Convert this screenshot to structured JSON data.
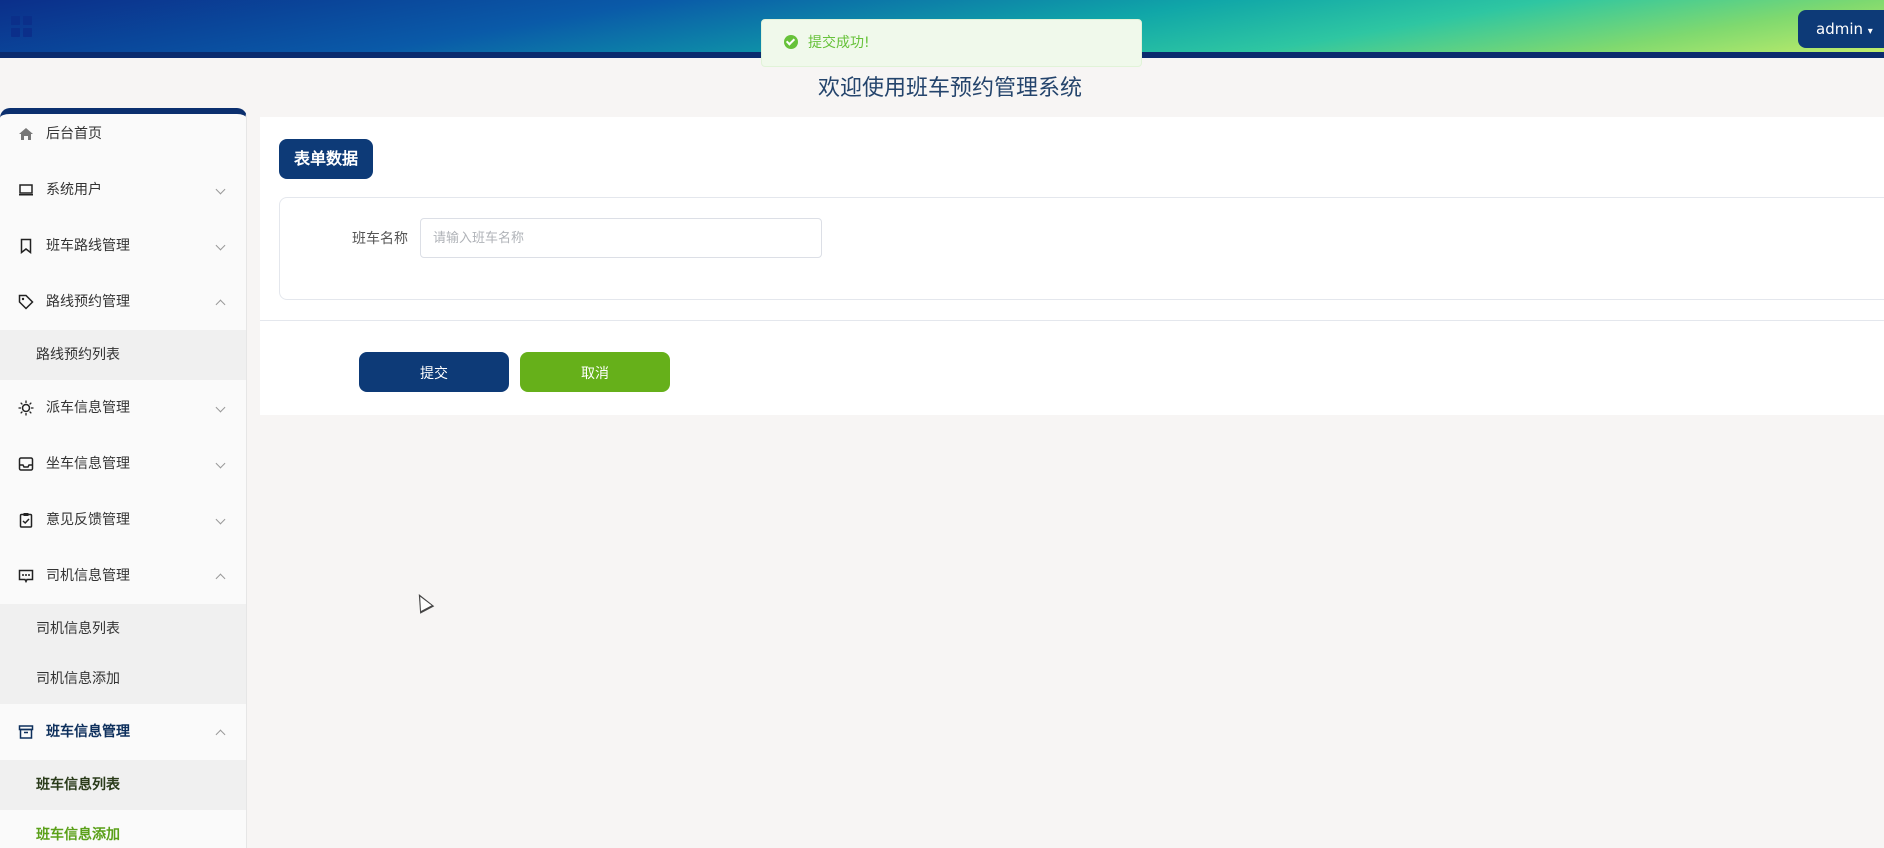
{
  "header": {
    "admin_label": "admin",
    "accent_color": "#0d3a77"
  },
  "toast": {
    "message": "提交成功!"
  },
  "welcome": {
    "title": "欢迎使用班车预约管理系统"
  },
  "sidebar": {
    "items": [
      {
        "label": "后台首页",
        "icon": "home-icon"
      },
      {
        "label": "系统用户",
        "icon": "monitor-icon"
      },
      {
        "label": "班车路线管理",
        "icon": "bookmark-icon"
      },
      {
        "label": "路线预约管理",
        "icon": "tag-icon"
      },
      {
        "label": "派车信息管理",
        "icon": "sun-icon"
      },
      {
        "label": "坐车信息管理",
        "icon": "inbox-icon"
      },
      {
        "label": "意见反馈管理",
        "icon": "clipboard-icon"
      },
      {
        "label": "司机信息管理",
        "icon": "message-icon"
      },
      {
        "label": "班车信息管理",
        "icon": "archive-icon"
      }
    ],
    "sub_items": {
      "route_booking_list": "路线预约列表",
      "driver_list": "司机信息列表",
      "driver_add": "司机信息添加",
      "bus_list": "班车信息列表",
      "bus_add": "班车信息添加"
    }
  },
  "form": {
    "section_title": "表单数据",
    "field_label": "班车名称",
    "field_placeholder": "请输入班车名称",
    "field_value": "",
    "submit_label": "提交",
    "cancel_label": "取消"
  }
}
